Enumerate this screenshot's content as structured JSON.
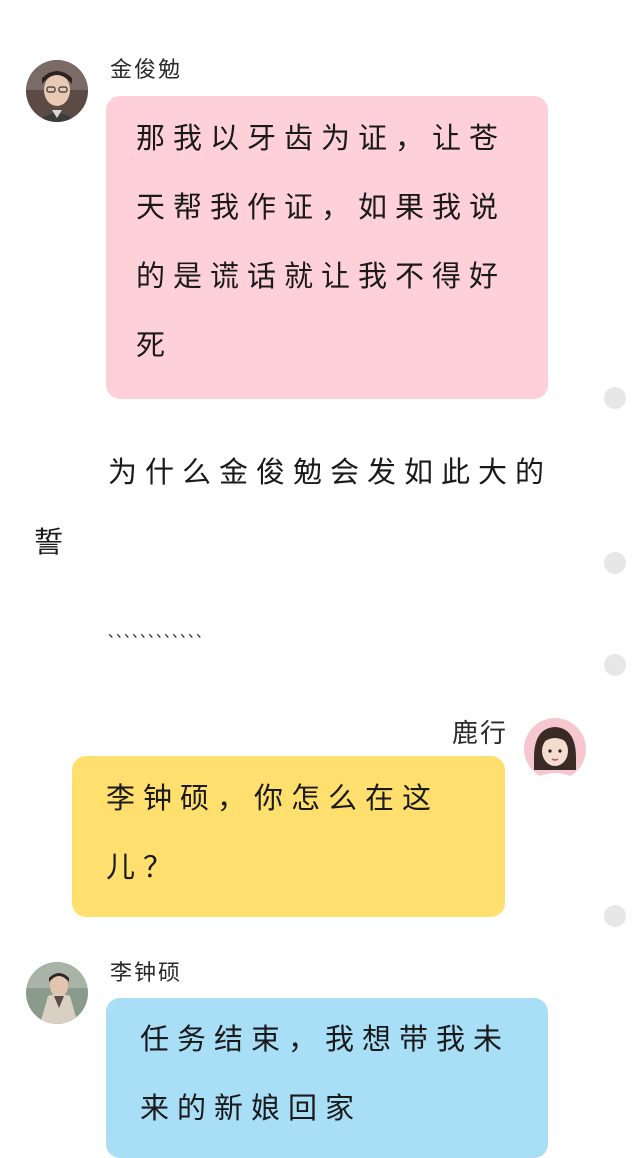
{
  "messages": [
    {
      "sender": "金俊勉",
      "avatar_icon": "portrait-avatar-man-glasses",
      "lines": [
        "那我以牙齿为证，让苍",
        "天帮我作证，如果我说",
        "的是谎话就让我不得好",
        "死"
      ],
      "bubble_color": "#fdd0da"
    },
    {
      "sender": "鹿行",
      "avatar_icon": "portrait-avatar-girl-pink",
      "lines": [
        "李钟硕，你怎么在这",
        "儿？"
      ],
      "bubble_color": "#ffdf6e"
    },
    {
      "sender": "李钟硕",
      "avatar_icon": "portrait-avatar-man-coat",
      "lines": [
        "任务结束，我想带我未",
        "来的新娘回家"
      ],
      "bubble_color": "#a8dff7"
    }
  ],
  "narration": {
    "line1": "为什么金俊勉会发如此大的",
    "line2": "誓",
    "ellipsis": "、、、、、、、、、、、、"
  },
  "indicator_icon": "grey-dot-icon"
}
